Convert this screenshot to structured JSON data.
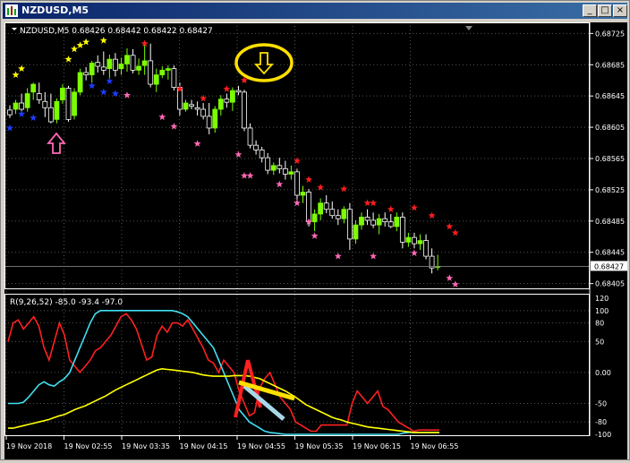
{
  "window": {
    "title": "NZDUSD,M5",
    "buttons": {
      "minimize": "_",
      "maximize": "□",
      "close": "×"
    }
  },
  "main_panel": {
    "header": "NZDUSD,M5  0.68426 0.68442 0.68422 0.68427",
    "price_labels": [
      "0.68725",
      "0.68685",
      "0.68645",
      "0.68605",
      "0.68565",
      "0.68525",
      "0.68485",
      "0.68445",
      "0.68405"
    ],
    "current_price": "0.68427"
  },
  "sub_panel": {
    "header": "R(9,26,52) -85.0 -93.4 -97.0",
    "labels": [
      "120",
      "100",
      "80",
      "50",
      "0.00",
      "-50",
      "-80",
      "-100"
    ]
  },
  "time_labels": [
    "19 Nov 2018",
    "19 Nov 02:55",
    "19 Nov 03:35",
    "19 Nov 04:15",
    "19 Nov 04:55",
    "19 Nov 05:35",
    "19 Nov 06:15",
    "19 Nov 06:55"
  ],
  "colors": {
    "bull": "#7cfc00",
    "bear": "#ffffff",
    "star_yellow": "#ffff00",
    "star_blue": "#1e3cff",
    "star_red": "#ff1e1e",
    "star_pink": "#ff69b4",
    "line_red": "#ff2020",
    "line_cyan": "#40e0f0",
    "line_yellow": "#ffff00"
  },
  "chart_data": {
    "type": "candlestick",
    "title": "NZDUSD,M5",
    "ylim": [
      0.684,
      0.6873
    ],
    "candles": [
      [
        0.68627,
        0.68633,
        0.68617,
        0.68621
      ],
      [
        0.68628,
        0.6864,
        0.68622,
        0.68636
      ],
      [
        0.68636,
        0.68648,
        0.6862,
        0.68628
      ],
      [
        0.6863,
        0.68655,
        0.68625,
        0.68648
      ],
      [
        0.6865,
        0.68662,
        0.6864,
        0.6866
      ],
      [
        0.68648,
        0.68662,
        0.68635,
        0.6864
      ],
      [
        0.68638,
        0.6865,
        0.68618,
        0.6863
      ],
      [
        0.6863,
        0.68648,
        0.6861,
        0.68612
      ],
      [
        0.68615,
        0.68642,
        0.6861,
        0.68638
      ],
      [
        0.6864,
        0.6866,
        0.68635,
        0.68655
      ],
      [
        0.68655,
        0.68658,
        0.68612,
        0.68615
      ],
      [
        0.6862,
        0.68655,
        0.68615,
        0.6865
      ],
      [
        0.6865,
        0.6868,
        0.68646,
        0.68675
      ],
      [
        0.68675,
        0.68682,
        0.68665,
        0.68672
      ],
      [
        0.68672,
        0.6869,
        0.68662,
        0.68687
      ],
      [
        0.68688,
        0.68697,
        0.68675,
        0.68683
      ],
      [
        0.68682,
        0.68702,
        0.68672,
        0.68678
      ],
      [
        0.6868,
        0.68698,
        0.68666,
        0.68692
      ],
      [
        0.68692,
        0.687,
        0.6867,
        0.68678
      ],
      [
        0.6868,
        0.68694,
        0.68672,
        0.68686
      ],
      [
        0.68686,
        0.68706,
        0.68676,
        0.68697
      ],
      [
        0.68697,
        0.68705,
        0.68674,
        0.68678
      ],
      [
        0.68678,
        0.68693,
        0.68672,
        0.68683
      ],
      [
        0.68684,
        0.6871,
        0.68672,
        0.6869
      ],
      [
        0.6869,
        0.68712,
        0.68656,
        0.6866
      ],
      [
        0.6866,
        0.6868,
        0.6865,
        0.68672
      ],
      [
        0.68672,
        0.68683,
        0.68668,
        0.68678
      ],
      [
        0.68678,
        0.68684,
        0.68666,
        0.6868
      ],
      [
        0.6868,
        0.68684,
        0.68652,
        0.68656
      ],
      [
        0.68656,
        0.68662,
        0.6862,
        0.68628
      ],
      [
        0.68628,
        0.6864,
        0.68625,
        0.68636
      ],
      [
        0.68634,
        0.6864,
        0.68628,
        0.68632
      ],
      [
        0.6863,
        0.68638,
        0.6862,
        0.68628
      ],
      [
        0.68628,
        0.68636,
        0.68615,
        0.68619
      ],
      [
        0.68619,
        0.68636,
        0.68596,
        0.68604
      ],
      [
        0.68604,
        0.68632,
        0.68598,
        0.68628
      ],
      [
        0.68628,
        0.68646,
        0.6862,
        0.68641
      ],
      [
        0.68641,
        0.68648,
        0.6863,
        0.68637
      ],
      [
        0.68637,
        0.68656,
        0.68626,
        0.68652
      ],
      [
        0.68652,
        0.68658,
        0.68646,
        0.6865
      ],
      [
        0.6865,
        0.68653,
        0.686,
        0.68604
      ],
      [
        0.68604,
        0.6861,
        0.68578,
        0.68582
      ],
      [
        0.68582,
        0.68588,
        0.6857,
        0.68576
      ],
      [
        0.68576,
        0.6858,
        0.6856,
        0.68566
      ],
      [
        0.68566,
        0.68572,
        0.68545,
        0.6855
      ],
      [
        0.6855,
        0.6856,
        0.68544,
        0.68556
      ],
      [
        0.68556,
        0.68566,
        0.68546,
        0.68552
      ],
      [
        0.68552,
        0.68562,
        0.68538,
        0.68545
      ],
      [
        0.68545,
        0.68556,
        0.68538,
        0.68548
      ],
      [
        0.68548,
        0.68552,
        0.68512,
        0.68518
      ],
      [
        0.68518,
        0.6853,
        0.68508,
        0.68522
      ],
      [
        0.68522,
        0.68526,
        0.68478,
        0.68484
      ],
      [
        0.68484,
        0.685,
        0.68472,
        0.68494
      ],
      [
        0.68494,
        0.68514,
        0.68486,
        0.68508
      ],
      [
        0.68508,
        0.68518,
        0.68495,
        0.685
      ],
      [
        0.685,
        0.6851,
        0.68488,
        0.68492
      ],
      [
        0.68492,
        0.685,
        0.6848,
        0.68488
      ],
      [
        0.68488,
        0.68504,
        0.68482,
        0.685
      ],
      [
        0.685,
        0.68508,
        0.68448,
        0.68462
      ],
      [
        0.68462,
        0.68486,
        0.68456,
        0.6848
      ],
      [
        0.6848,
        0.68496,
        0.68474,
        0.6849
      ],
      [
        0.6849,
        0.685,
        0.6848,
        0.68486
      ],
      [
        0.68486,
        0.68496,
        0.68476,
        0.6848
      ],
      [
        0.6848,
        0.68494,
        0.68468,
        0.68488
      ],
      [
        0.68488,
        0.68496,
        0.68478,
        0.68484
      ],
      [
        0.68484,
        0.68494,
        0.68476,
        0.68478
      ],
      [
        0.68478,
        0.68496,
        0.68472,
        0.6849
      ],
      [
        0.6849,
        0.68496,
        0.6845,
        0.68458
      ],
      [
        0.68458,
        0.6847,
        0.68452,
        0.68464
      ],
      [
        0.68464,
        0.6847,
        0.6845,
        0.68456
      ],
      [
        0.68456,
        0.68468,
        0.68448,
        0.6846
      ],
      [
        0.6846,
        0.68468,
        0.68436,
        0.6844
      ],
      [
        0.6844,
        0.6845,
        0.68418,
        0.68425
      ],
      [
        0.68426,
        0.68442,
        0.68422,
        0.68427
      ]
    ],
    "markers": {
      "yellow_above": [
        [
          1,
          0.68672
        ],
        [
          2,
          0.6868
        ],
        [
          10,
          0.68692
        ],
        [
          11,
          0.68705
        ],
        [
          12,
          0.6871
        ],
        [
          13,
          0.68714
        ],
        [
          16,
          0.68716
        ]
      ],
      "blue_below": [
        [
          0,
          0.68604
        ],
        [
          2,
          0.68622
        ],
        [
          4,
          0.68617
        ],
        [
          14,
          0.68658
        ],
        [
          16,
          0.6865
        ],
        [
          17,
          0.68664
        ],
        [
          18,
          0.68648
        ]
      ],
      "red_above": [
        [
          23,
          0.68712
        ],
        [
          29,
          0.68654
        ],
        [
          33,
          0.68642
        ],
        [
          37,
          0.68654
        ],
        [
          40,
          0.68665
        ],
        [
          49,
          0.68562
        ],
        [
          51,
          0.68538
        ],
        [
          53,
          0.68528
        ],
        [
          57,
          0.68526
        ],
        [
          61,
          0.68508
        ],
        [
          62,
          0.68508
        ],
        [
          65,
          0.685
        ],
        [
          69,
          0.68502
        ],
        [
          72,
          0.68492
        ],
        [
          75,
          0.68478
        ],
        [
          76,
          0.6847
        ]
      ],
      "pink_below": [
        [
          20,
          0.68646
        ],
        [
          26,
          0.68618
        ],
        [
          28,
          0.68606
        ],
        [
          32,
          0.68584
        ],
        [
          39,
          0.6857
        ],
        [
          40,
          0.68543
        ],
        [
          41,
          0.68543
        ],
        [
          46,
          0.68532
        ],
        [
          49,
          0.68508
        ],
        [
          51,
          0.68484
        ],
        [
          52,
          0.68466
        ],
        [
          56,
          0.6844
        ],
        [
          62,
          0.6844
        ],
        [
          69,
          0.68444
        ],
        [
          75,
          0.68412
        ],
        [
          76,
          0.68404
        ]
      ]
    },
    "oscillator": {
      "name": "R(9,26,52)",
      "ylim": [
        -100,
        120
      ],
      "series": [
        {
          "values": [
            50,
            80,
            85,
            70,
            80,
            90,
            75,
            40,
            20,
            50,
            80,
            60,
            20,
            10,
            0,
            10,
            20,
            35,
            40,
            50,
            60,
            75,
            90,
            95,
            85,
            70,
            45,
            20,
            25,
            60,
            75,
            65,
            80,
            80,
            75,
            85,
            70,
            55,
            40,
            20,
            15,
            0,
            20,
            10,
            0,
            -30,
            -50,
            -70,
            -65,
            -25,
            -10,
            0,
            -20,
            -40,
            -50,
            -60,
            -80,
            -85,
            -90,
            -95,
            -95,
            -85,
            -85,
            -85,
            -85,
            -85,
            -85,
            -50,
            -30,
            -40,
            -50,
            -40,
            -30,
            -55,
            -60,
            -70,
            -80,
            -85,
            -90,
            -95,
            -93,
            -93,
            -93,
            -93,
            -93
          ]
        },
        {
          "values": [
            -50,
            -50,
            -50,
            -48,
            -40,
            -30,
            -20,
            -15,
            -20,
            -22,
            -15,
            -10,
            0,
            20,
            40,
            60,
            80,
            95,
            100,
            100,
            100,
            100,
            100,
            100,
            100,
            100,
            100,
            100,
            100,
            100,
            100,
            100,
            100,
            98,
            95,
            90,
            80,
            70,
            60,
            50,
            40,
            20,
            0,
            -20,
            -40,
            -60,
            -70,
            -80,
            -85,
            -90,
            -95,
            -97,
            -98,
            -99,
            -100,
            -100,
            -100,
            -100,
            -100,
            -100,
            -100,
            -100,
            -100,
            -100,
            -100,
            -100,
            -100,
            -100,
            -100,
            -100,
            -100,
            -100,
            -100,
            -100,
            -100,
            -100,
            -100,
            -98,
            -97,
            -97,
            -97,
            -97,
            -97,
            -97,
            -97
          ]
        },
        {
          "values": [
            -90,
            -90,
            -88,
            -86,
            -84,
            -82,
            -80,
            -78,
            -76,
            -73,
            -70,
            -68,
            -64,
            -60,
            -57,
            -54,
            -50,
            -46,
            -42,
            -38,
            -33,
            -28,
            -24,
            -20,
            -16,
            -12,
            -8,
            -4,
            0,
            4,
            6,
            5,
            4,
            3,
            2,
            1,
            0,
            -2,
            -4,
            -5,
            -6,
            -6,
            -6,
            -6,
            -5,
            -5,
            -5,
            -6,
            -8,
            -10,
            -14,
            -18,
            -22,
            -26,
            -30,
            -35,
            -40,
            -46,
            -52,
            -56,
            -60,
            -64,
            -68,
            -72,
            -75,
            -77,
            -80,
            -82,
            -84,
            -86,
            -88,
            -89,
            -90,
            -91,
            -92,
            -93,
            -94,
            -95,
            -96,
            -97,
            -97,
            -97,
            -97,
            -97,
            -97
          ]
        }
      ]
    }
  }
}
